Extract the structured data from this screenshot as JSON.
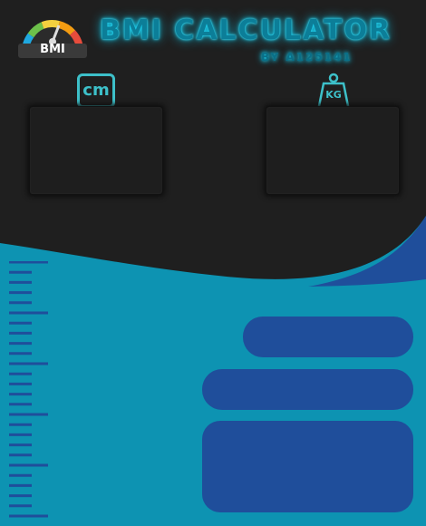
{
  "app": {
    "title": "BMI CALCULATOR",
    "byline": "BY A125141",
    "logo_label": "BMI"
  },
  "units": {
    "height_unit": "cm",
    "weight_unit": "KG"
  },
  "inputs": {
    "height_value": "",
    "weight_value": ""
  },
  "colors": {
    "dark_panel": "#1e1e1e",
    "teal_bg": "#0d93b2",
    "accent_blue": "#1f4e9b",
    "neon": "#16d4f5",
    "icon_teal": "#3dc0c9"
  },
  "icons": {
    "logo": "bmi-gauge-icon",
    "height": "cm-ruler-icon",
    "weight": "kg-weight-icon"
  }
}
